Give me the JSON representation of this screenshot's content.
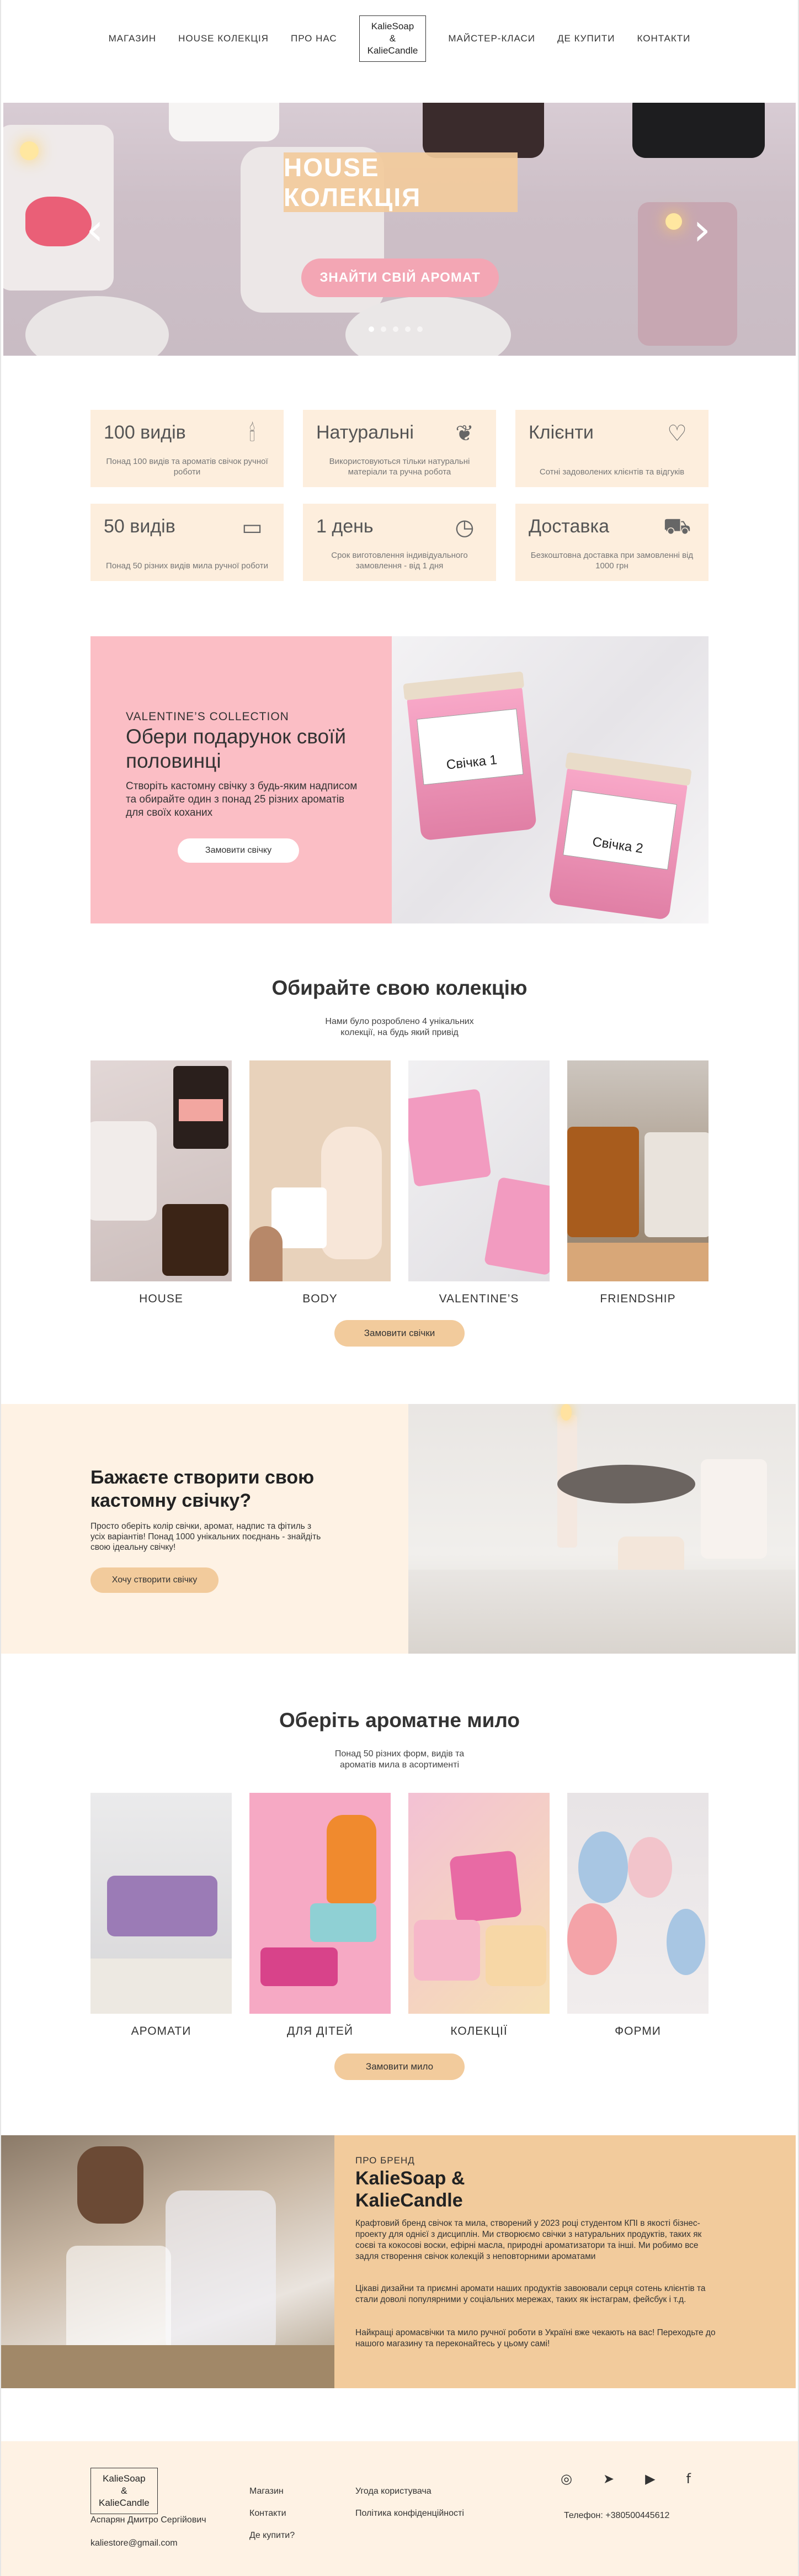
{
  "nav": {
    "left": [
      "МАГАЗИН",
      "HOUSE КОЛЕКЦІЯ",
      "ПРО НАС"
    ],
    "logo": [
      "KalieSoap",
      "&",
      "KalieCandle"
    ],
    "right": [
      "МАЙСТЕР-КЛАСИ",
      "ДЕ КУПИТИ",
      "КОНТАКТИ"
    ]
  },
  "hero": {
    "title": "HOUSE КОЛЕКЦІЯ",
    "button": "ЗНАЙТИ СВІЙ АРОМАТ",
    "prev": "‹",
    "next": "›"
  },
  "features": [
    {
      "title": "100 видів",
      "text": "Понад 100 видів та ароматів свічок ручної роботи",
      "icon": "candle-icon",
      "glyph": "🕯"
    },
    {
      "title": "Натуральні",
      "text": "Використовуються тільки натуральні матеріали та ручна робота",
      "icon": "leaf-icon",
      "glyph": "❦"
    },
    {
      "title": "Клієнти",
      "text": "Сотні задоволених клієнтів та відгуків",
      "icon": "hearts-icon",
      "glyph": "♡"
    },
    {
      "title": "50 видів",
      "text": "Понад 50 різних видів мила ручної роботи",
      "icon": "soap-icon",
      "glyph": "▭"
    },
    {
      "title": "1 день",
      "text": "Срок виготовлення індивідуального замовлення - від 1 дня",
      "icon": "clock-icon",
      "glyph": "◷"
    },
    {
      "title": "Доставка",
      "text": "Безкоштовна доставка при замовленні від 1000 грн",
      "icon": "truck-icon",
      "glyph": "⛟"
    }
  ],
  "valentine": {
    "eyebrow": "VALENTINE’S COLLECTION",
    "title": "Обери подарунок своїй половинці",
    "text": "Створіть кастомну свічку з будь-яким надписом та обирайте один з понад 25 різних ароматів для своїх коханих",
    "button": "Замовити свічку",
    "jar1": "Свічка 1",
    "jar2": "Свічка 2"
  },
  "collection": {
    "title": "Обирайте свою колекцію",
    "subtitle": "Нами було розроблено 4 унікальних колекції, на будь який привід",
    "items": [
      "HOUSE",
      "BODY",
      "VALENTINE’S",
      "FRIENDSHIP"
    ],
    "button": "Замовити свічки"
  },
  "custom": {
    "title": "Бажаєте створити свою кастомну свічку?",
    "text": "Просто оберіть колір свічки, аромат, надпис та фітиль з усіх варіантів! Понад 1000 унікальних поєднань - знайдіть свою ідеальну свічку!",
    "button": "Хочу створити свічку"
  },
  "soap": {
    "title": "Оберіть ароматне мило",
    "subtitle": "Понад 50 різних форм, видів та ароматів мила в асортименті",
    "items": [
      "АРОМАТИ",
      "ДЛЯ ДІТЕЙ",
      "КОЛЕКЦІЇ",
      "ФОРМИ"
    ],
    "button": "Замовити мило"
  },
  "brand": {
    "eyebrow": "ПРО БРЕНД",
    "title": "KalieSoap & KalieCandle",
    "p1": "Крафтовий бренд свічок та мила, створений у 2023 році студентом КПІ в якості бізнес-проекту для однієї з дисциплін. Ми створюємо свічки з натуральних продуктів, таких як соєві та кокосові воски, ефірні масла, природні ароматизатори та інші. Ми робимо все задля створення свічок колекцій з неповторними ароматами",
    "p2": "Цікаві дизайни та приємні аромати наших продуктів завоювали серця сотень клієнтів та стали доволі популярними у соціальних мережах, таких як інстаграм, фейсбук і т.д.",
    "p3": "Найкращі аромасвічки та мило ручної роботи в Україні вже чекають на вас! Переходьте до нашого магазину та переконайтесь у цьому самі!"
  },
  "footer": {
    "logo": [
      "KalieSoap",
      "&",
      "KalieCandle"
    ],
    "name": "Аспарян Дмитро Сергійович",
    "email": "kaliestore@gmail.com",
    "col1": [
      "Магазин",
      "Контакти",
      "Де купити?"
    ],
    "col2": [
      "Угода користувача",
      "Політика конфіденційності"
    ],
    "phone": "Телефон: +380500445612",
    "icons": [
      {
        "name": "instagram-icon",
        "glyph": "◎"
      },
      {
        "name": "telegram-icon",
        "glyph": "➤"
      },
      {
        "name": "youtube-icon",
        "glyph": "▶"
      },
      {
        "name": "facebook-icon",
        "glyph": "f"
      }
    ]
  }
}
